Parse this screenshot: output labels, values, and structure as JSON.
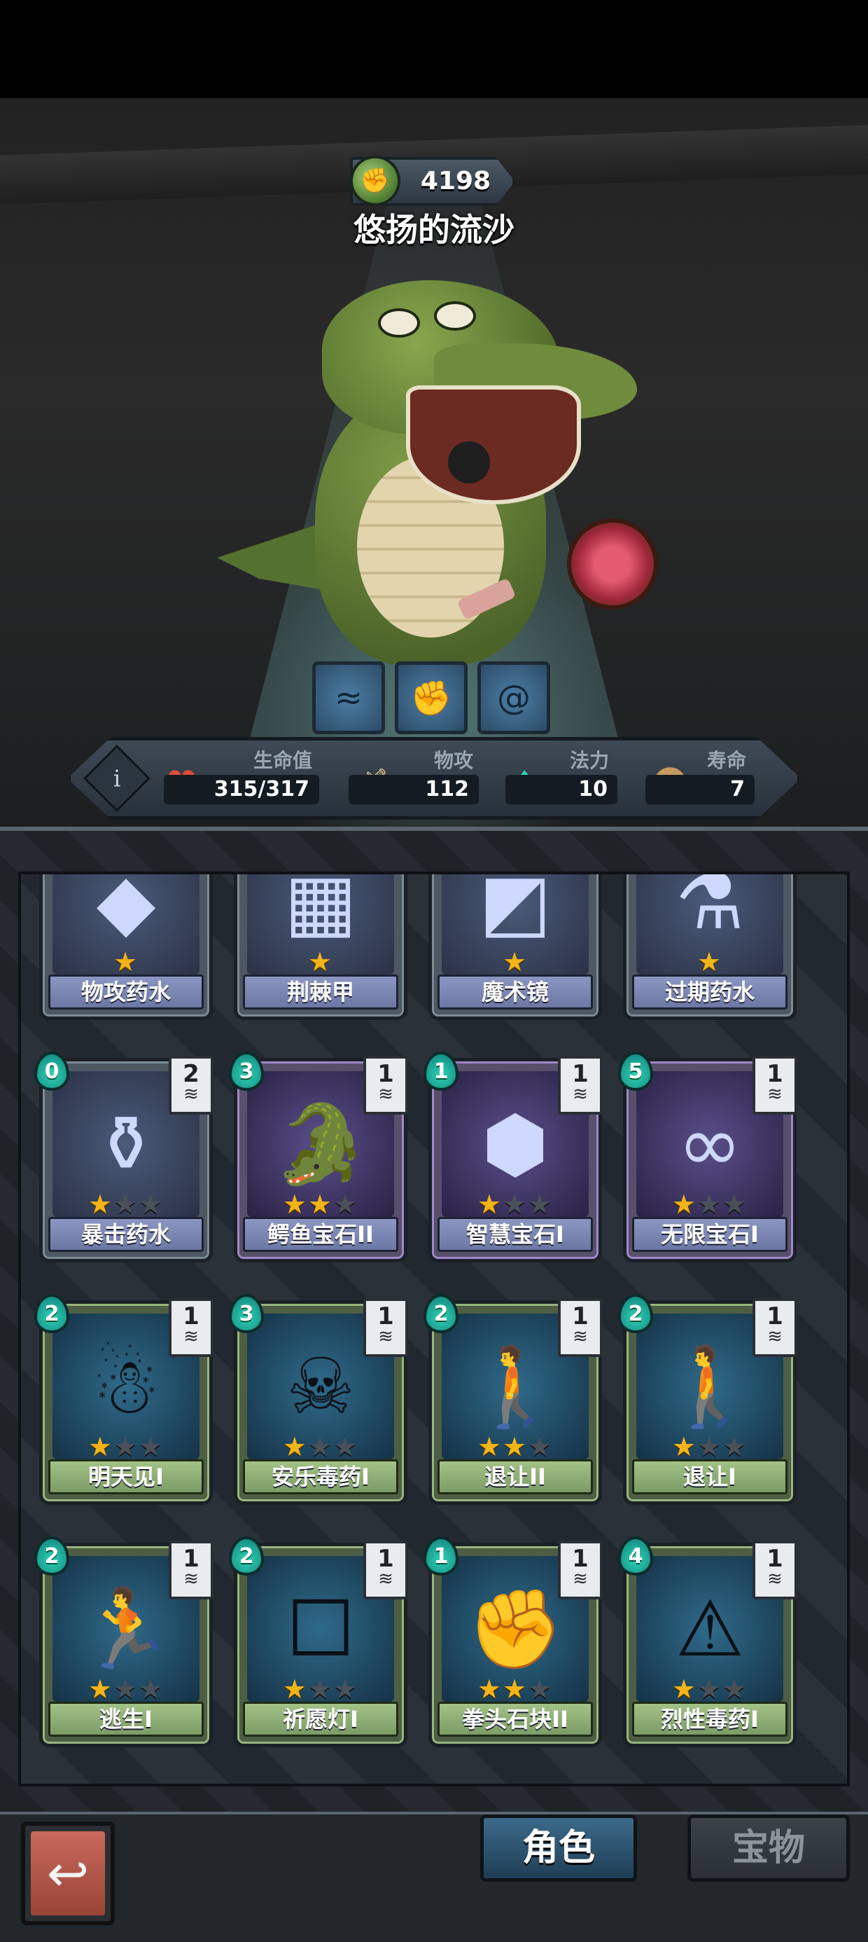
{
  "hero": {
    "currency_value": "4198",
    "currency_icon": "green-spiral-coin-icon",
    "name": "悠扬的流沙"
  },
  "skills": [
    "skill-water-icon",
    "skill-fist-icon",
    "skill-swirl-icon"
  ],
  "stats": {
    "hp_label": "生命值",
    "hp_value": "315/317",
    "atk_label": "物攻",
    "atk_value": "112",
    "mp_label": "法力",
    "mp_value": "10",
    "life_label": "寿命",
    "life_value": "7"
  },
  "cards": [
    {
      "name": "物攻药水",
      "stars": 1,
      "cost": "",
      "stack": "",
      "rarity": "blue",
      "icon": "potion-gem-icon"
    },
    {
      "name": "荆棘甲",
      "stars": 1,
      "cost": "",
      "stack": "",
      "rarity": "blue",
      "icon": "spiked-armor-icon"
    },
    {
      "name": "魔术镜",
      "stars": 1,
      "cost": "",
      "stack": "",
      "rarity": "blue",
      "icon": "magic-mirror-icon"
    },
    {
      "name": "过期药水",
      "stars": 1,
      "cost": "",
      "stack": "",
      "rarity": "blue",
      "icon": "expired-potion-icon"
    },
    {
      "name": "暴击药水",
      "stars": 1,
      "cost": "0",
      "stack": "2",
      "rarity": "blue",
      "icon": "crit-potion-icon"
    },
    {
      "name": "鳄鱼宝石II",
      "stars": 2,
      "cost": "3",
      "stack": "1",
      "rarity": "purple",
      "icon": "croc-gem-icon"
    },
    {
      "name": "智慧宝石I",
      "stars": 1,
      "cost": "1",
      "stack": "1",
      "rarity": "purple",
      "icon": "wisdom-gem-icon"
    },
    {
      "name": "无限宝石I",
      "stars": 1,
      "cost": "5",
      "stack": "1",
      "rarity": "purple",
      "icon": "infinity-gem-icon"
    },
    {
      "name": "明天见I",
      "stars": 1,
      "cost": "2",
      "stack": "1",
      "rarity": "green",
      "icon": "ghost-hug-icon"
    },
    {
      "name": "安乐毒药I",
      "stars": 1,
      "cost": "3",
      "stack": "1",
      "rarity": "green",
      "icon": "poison-flask-icon"
    },
    {
      "name": "退让II",
      "stars": 2,
      "cost": "2",
      "stack": "1",
      "rarity": "green",
      "icon": "retreat-silhouette-icon"
    },
    {
      "name": "退让I",
      "stars": 1,
      "cost": "2",
      "stack": "1",
      "rarity": "green",
      "icon": "retreat-silhouette-icon"
    },
    {
      "name": "逃生I",
      "stars": 1,
      "cost": "2",
      "stack": "1",
      "rarity": "green",
      "icon": "escape-runner-icon"
    },
    {
      "name": "祈愿灯I",
      "stars": 1,
      "cost": "2",
      "stack": "1",
      "rarity": "green",
      "icon": "wish-lantern-icon"
    },
    {
      "name": "拳头石块II",
      "stars": 2,
      "cost": "1",
      "stack": "1",
      "rarity": "green",
      "icon": "fist-stone-icon"
    },
    {
      "name": "烈性毒药I",
      "stars": 1,
      "cost": "4",
      "stack": "1",
      "rarity": "green",
      "icon": "strong-poison-icon"
    }
  ],
  "tabs": {
    "active": "角色",
    "inactive": "宝物"
  },
  "colors": {
    "star": "#f2b418",
    "cost": "#2fd1b6",
    "accent": "#3c6a8a"
  }
}
